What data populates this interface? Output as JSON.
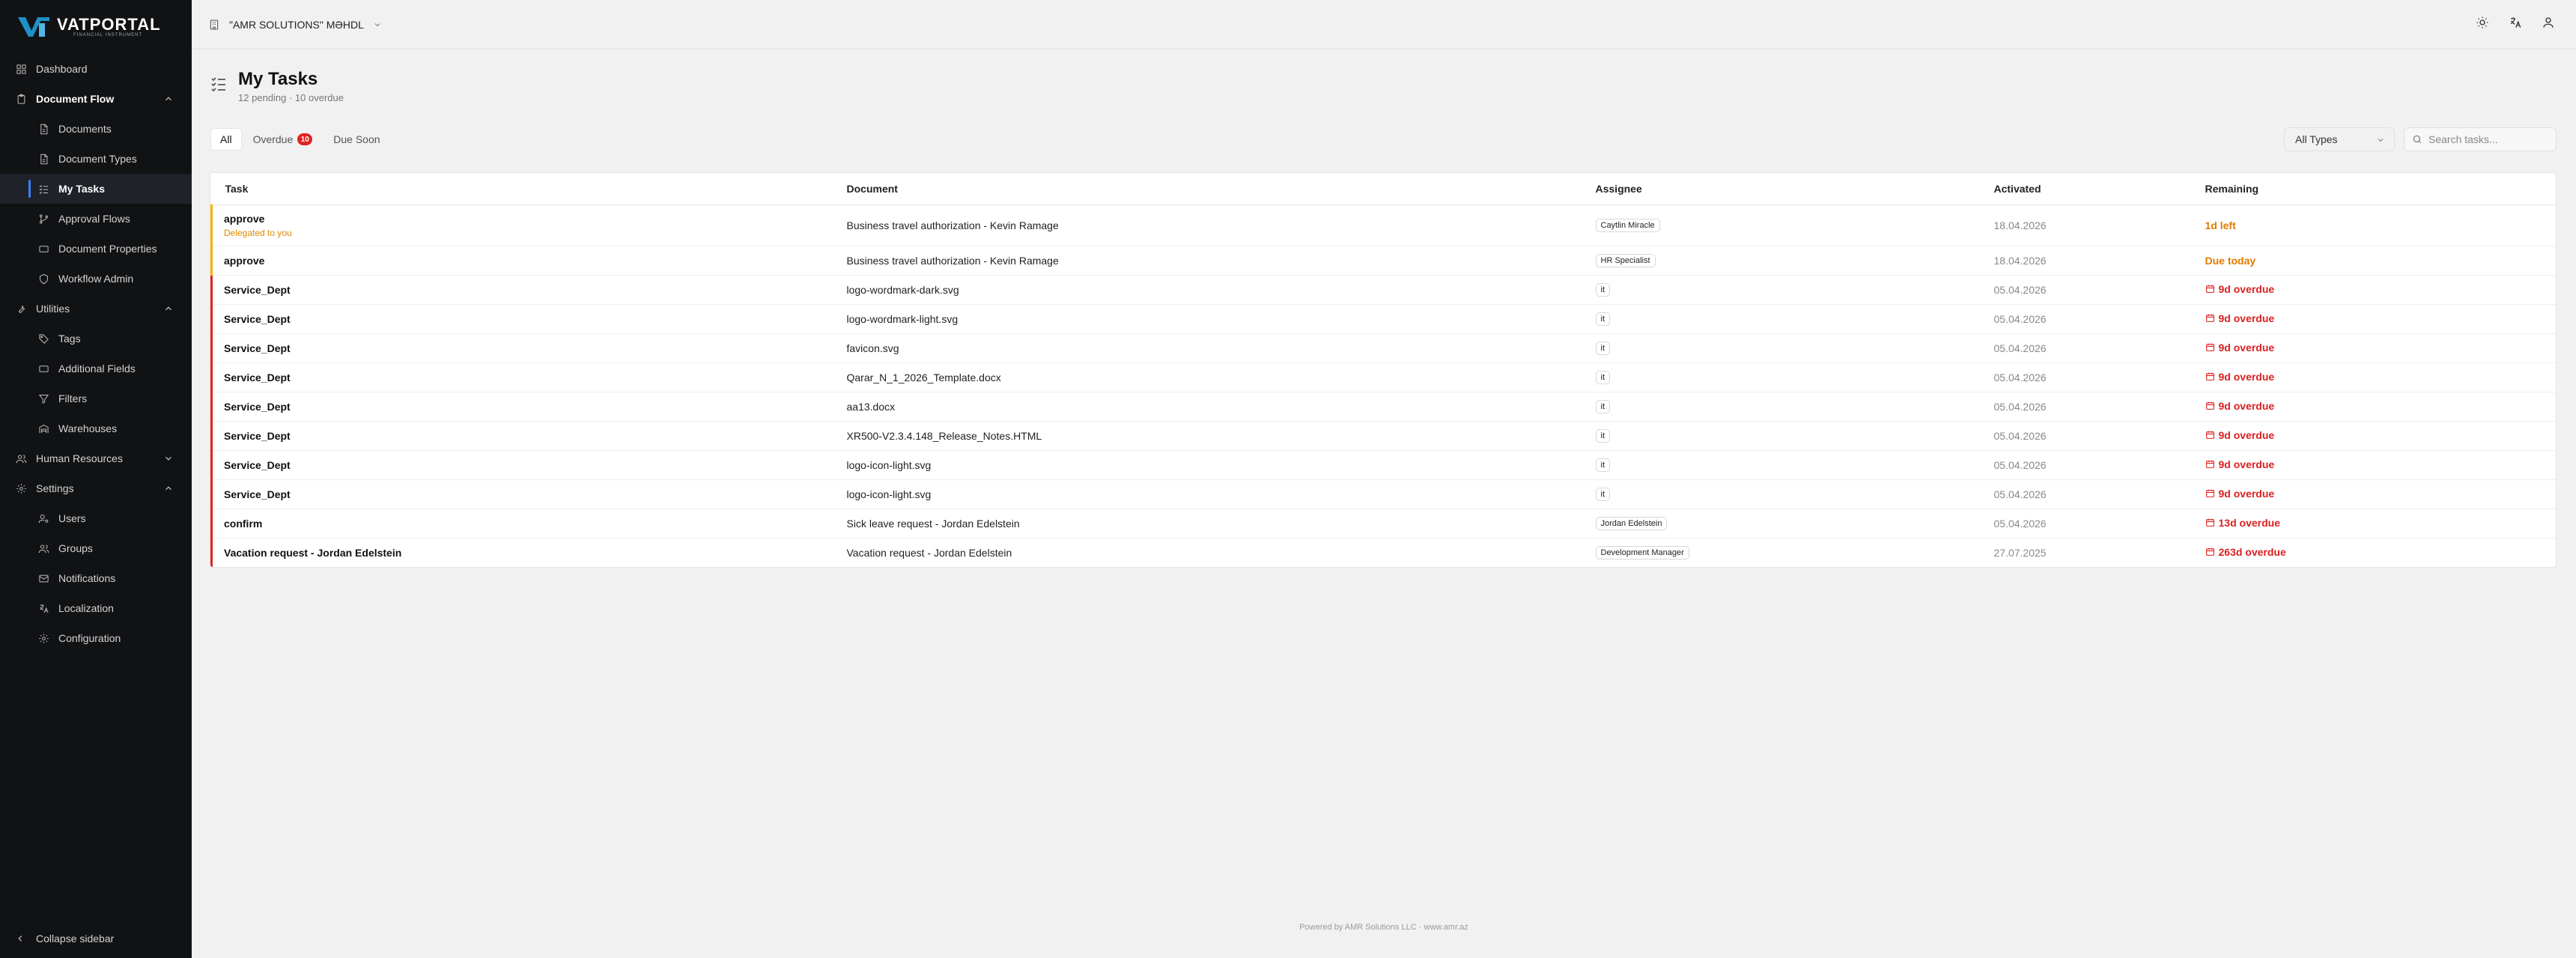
{
  "brand": {
    "name": "VATPORTAL",
    "tagline": "FINANCIAL INSTRUMENT"
  },
  "sidebar": {
    "items": [
      {
        "label": "Dashboard",
        "icon": "grid-icon",
        "level": "top"
      },
      {
        "label": "Document Flow",
        "icon": "clipboard-icon",
        "level": "top",
        "group": "open"
      },
      {
        "label": "Documents",
        "icon": "file-icon",
        "level": "sub"
      },
      {
        "label": "Document Types",
        "icon": "file-icon",
        "level": "sub"
      },
      {
        "label": "My Tasks",
        "icon": "list-checks-icon",
        "level": "sub",
        "active": true
      },
      {
        "label": "Approval Flows",
        "icon": "git-branch-icon",
        "level": "sub"
      },
      {
        "label": "Document Properties",
        "icon": "rectangle-icon",
        "level": "sub"
      },
      {
        "label": "Workflow Admin",
        "icon": "shield-icon",
        "level": "sub"
      },
      {
        "label": "Utilities",
        "icon": "wrench-icon",
        "level": "top",
        "group": "open"
      },
      {
        "label": "Tags",
        "icon": "tag-icon",
        "level": "sub"
      },
      {
        "label": "Additional Fields",
        "icon": "rectangle-icon",
        "level": "sub"
      },
      {
        "label": "Filters",
        "icon": "filter-icon",
        "level": "sub"
      },
      {
        "label": "Warehouses",
        "icon": "warehouse-icon",
        "level": "sub"
      },
      {
        "label": "Human Resources",
        "icon": "users-icon",
        "level": "top",
        "group": "closed"
      },
      {
        "label": "Settings",
        "icon": "gear-icon",
        "level": "top",
        "group": "open"
      },
      {
        "label": "Users",
        "icon": "user-cog-icon",
        "level": "sub"
      },
      {
        "label": "Groups",
        "icon": "users-icon",
        "level": "sub"
      },
      {
        "label": "Notifications",
        "icon": "mail-icon",
        "level": "sub"
      },
      {
        "label": "Localization",
        "icon": "languages-icon",
        "level": "sub"
      },
      {
        "label": "Configuration",
        "icon": "gear-icon",
        "level": "sub"
      }
    ],
    "collapse_label": "Collapse sidebar"
  },
  "header": {
    "company": "\"AMR SOLUTIONS\" MƏHDL"
  },
  "page": {
    "title": "My Tasks",
    "subtitle": "12 pending · 10 overdue"
  },
  "filters": {
    "tabs": [
      {
        "label": "All",
        "active": true
      },
      {
        "label": "Overdue",
        "badge": "10"
      },
      {
        "label": "Due Soon"
      }
    ],
    "type_select": "All Types",
    "search_placeholder": "Search tasks..."
  },
  "table": {
    "headers": [
      "Task",
      "Document",
      "Assignee",
      "Activated",
      "Remaining"
    ],
    "rows": [
      {
        "task": "approve",
        "note": "Delegated to you",
        "document": "Business travel authorization - Kevin Ramage",
        "assignee": "Caytlin Miracle",
        "activated": "18.04.2026",
        "remaining": "1d left",
        "status": "warn"
      },
      {
        "task": "approve",
        "document": "Business travel authorization - Kevin Ramage",
        "assignee": "HR Specialist",
        "activated": "18.04.2026",
        "remaining": "Due today",
        "status": "warn"
      },
      {
        "task": "Service_Dept",
        "document": "logo-wordmark-dark.svg",
        "assignee": "it",
        "activated": "05.04.2026",
        "remaining": "9d overdue",
        "status": "overdue"
      },
      {
        "task": "Service_Dept",
        "document": "logo-wordmark-light.svg",
        "assignee": "it",
        "activated": "05.04.2026",
        "remaining": "9d overdue",
        "status": "overdue"
      },
      {
        "task": "Service_Dept",
        "document": "favicon.svg",
        "assignee": "it",
        "activated": "05.04.2026",
        "remaining": "9d overdue",
        "status": "overdue"
      },
      {
        "task": "Service_Dept",
        "document": "Qarar_N_1_2026_Template.docx",
        "assignee": "it",
        "activated": "05.04.2026",
        "remaining": "9d overdue",
        "status": "overdue"
      },
      {
        "task": "Service_Dept",
        "document": "aa13.docx",
        "assignee": "it",
        "activated": "05.04.2026",
        "remaining": "9d overdue",
        "status": "overdue"
      },
      {
        "task": "Service_Dept",
        "document": "XR500-V2.3.4.148_Release_Notes.HTML",
        "assignee": "it",
        "activated": "05.04.2026",
        "remaining": "9d overdue",
        "status": "overdue"
      },
      {
        "task": "Service_Dept",
        "document": "logo-icon-light.svg",
        "assignee": "it",
        "activated": "05.04.2026",
        "remaining": "9d overdue",
        "status": "overdue"
      },
      {
        "task": "Service_Dept",
        "document": "logo-icon-light.svg",
        "assignee": "it",
        "activated": "05.04.2026",
        "remaining": "9d overdue",
        "status": "overdue"
      },
      {
        "task": "confirm",
        "document": "Sick leave request - Jordan Edelstein",
        "assignee": "Jordan Edelstein",
        "activated": "05.04.2026",
        "remaining": "13d overdue",
        "status": "overdue"
      },
      {
        "task": "Vacation request - Jordan Edelstein",
        "document": "Vacation request - Jordan Edelstein",
        "assignee": "Development Manager",
        "activated": "27.07.2025",
        "remaining": "263d overdue",
        "status": "overdue"
      }
    ]
  },
  "footer": "Powered by AMR Solutions LLC · www.amr.az",
  "colors": {
    "accent": "#3b82f6",
    "overdue": "#d92020",
    "warning": "#e07b00",
    "sidebar_bg": "#111214"
  }
}
